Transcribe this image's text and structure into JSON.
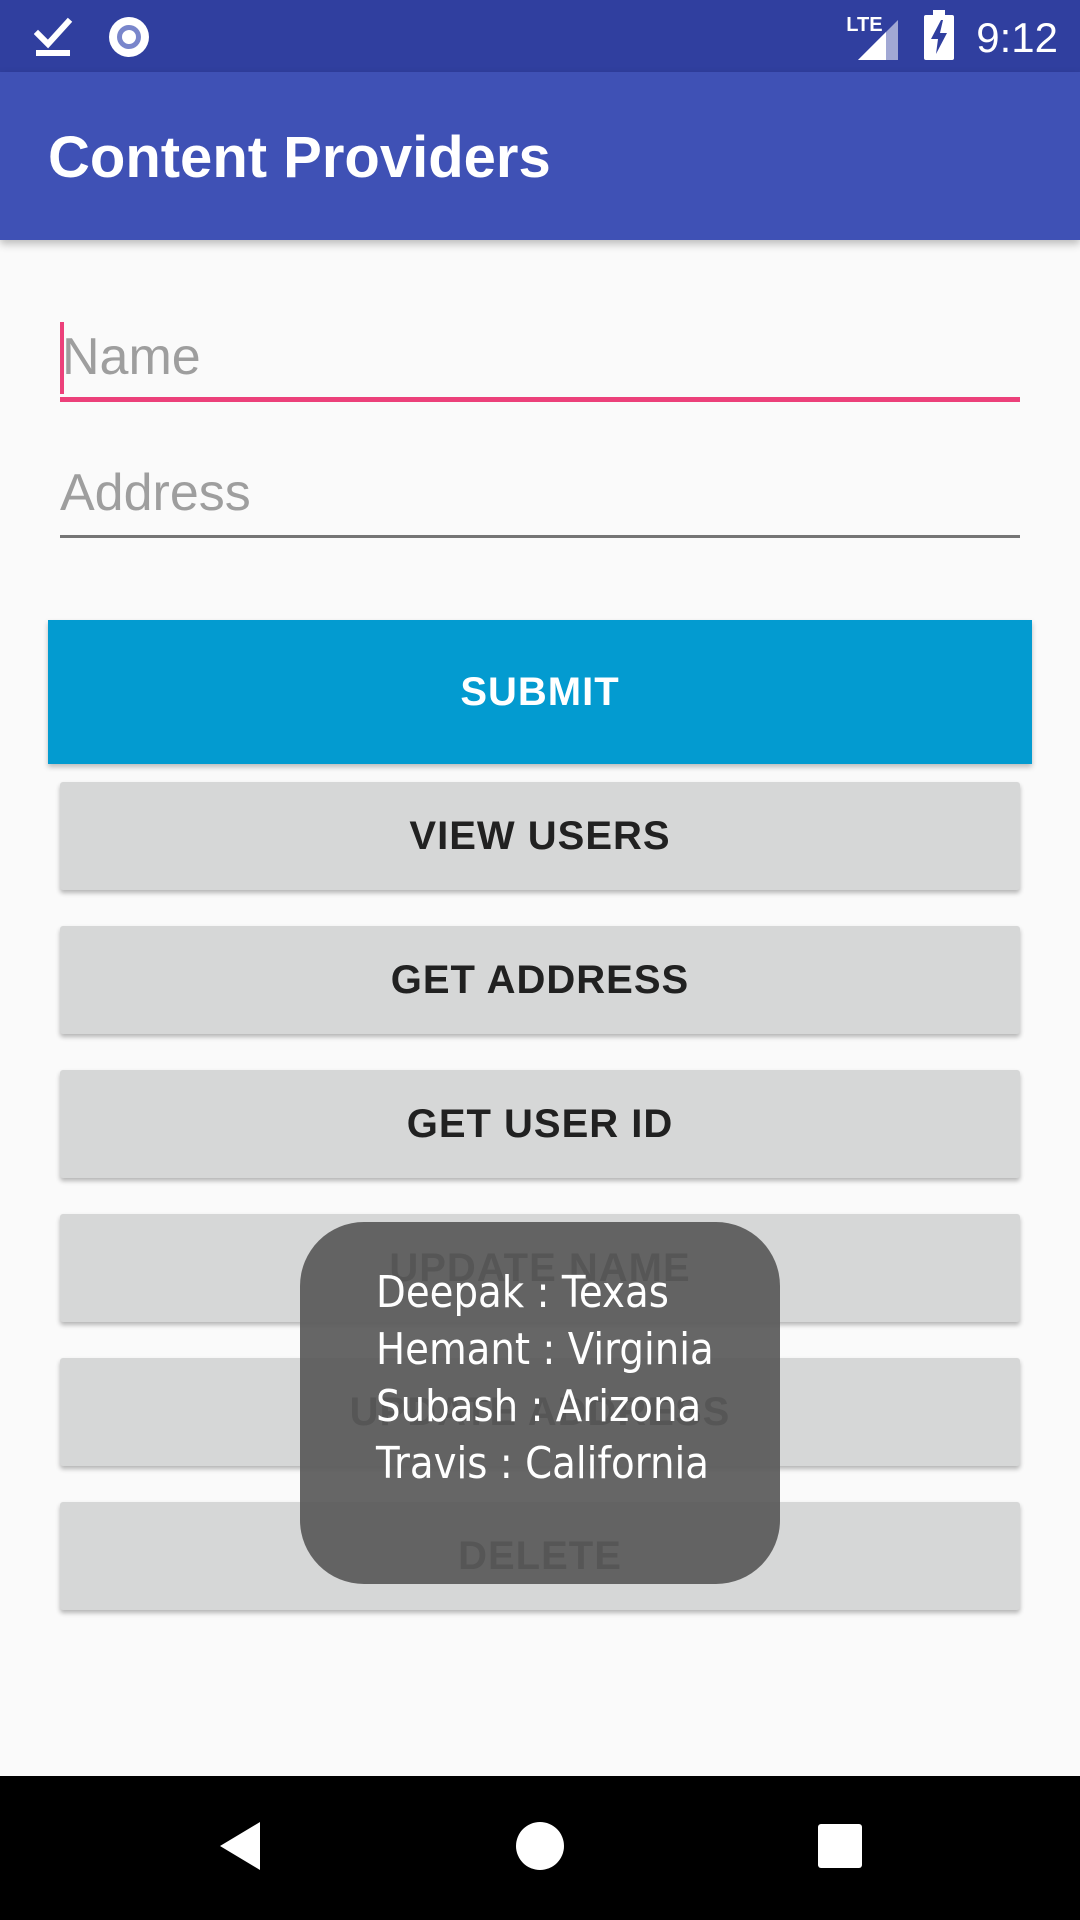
{
  "status_bar": {
    "time": "9:12",
    "network": "LTE",
    "icons": [
      "task-done-icon",
      "sync-circle-icon",
      "signal-icon",
      "battery-charging-icon"
    ]
  },
  "app_bar": {
    "title": "Content Providers"
  },
  "form": {
    "name": {
      "placeholder": "Name",
      "value": ""
    },
    "address": {
      "placeholder": "Address",
      "value": ""
    }
  },
  "buttons": {
    "submit": "SUBMIT",
    "view_users": "VIEW USERS",
    "get_address": "GET ADDRESS",
    "get_user_id": "GET USER ID",
    "update_name": "UPDATE NAME",
    "update_address": "UPDATE ADDRESS",
    "delete": "DELETE"
  },
  "toast": {
    "lines": [
      "Deepak : Texas",
      "Hemant : Virginia",
      "Subash : Arizona",
      "Travis : California"
    ]
  },
  "nav": {
    "icons": [
      "back-icon",
      "home-icon",
      "recents-icon"
    ]
  },
  "colors": {
    "status_bar": "#303f9f",
    "app_bar": "#3f51b5",
    "accent": "#ec407a",
    "primary_button": "#039bd0",
    "secondary_button": "#d6d7d7"
  }
}
